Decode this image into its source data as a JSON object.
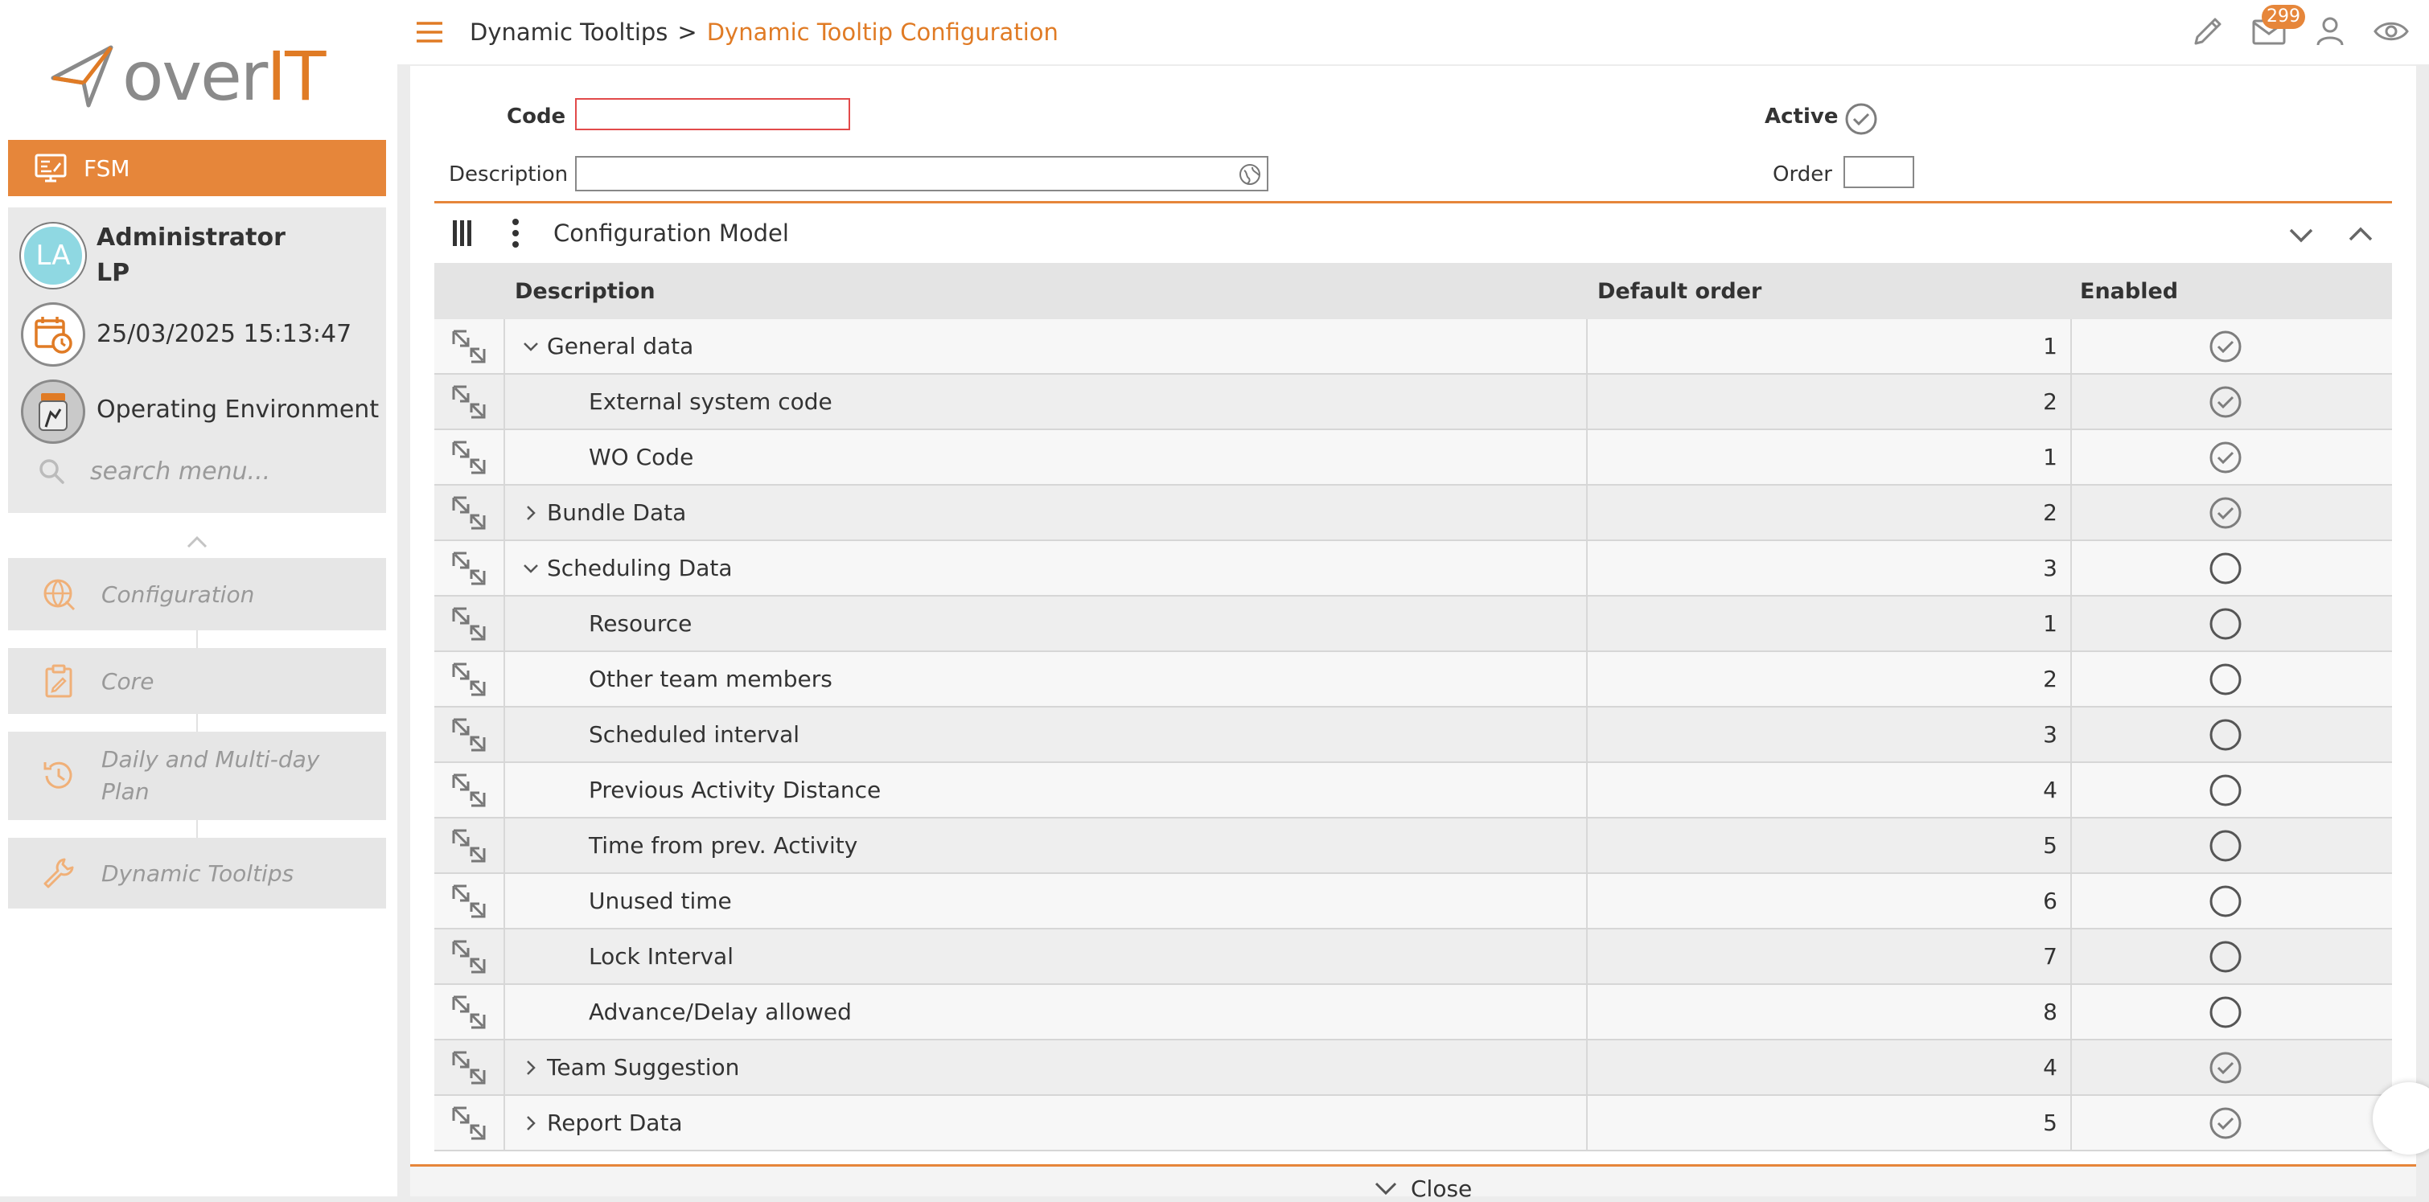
{
  "brand": {
    "logo_part1": "over",
    "logo_part2": "IT",
    "accent": "#e6863a"
  },
  "sidebar": {
    "module": "FSM",
    "user_initials": "LA",
    "user_name_line1": "Administrator",
    "user_name_line2": "LP",
    "datetime": "25/03/2025 15:13:47",
    "environment": "Operating Environment",
    "search_placeholder": "search menu...",
    "items": [
      {
        "label": "Configuration",
        "icon": "globe-icon"
      },
      {
        "label": "Core",
        "icon": "clipboard-edit-icon"
      },
      {
        "label": "Daily and Multi-day Plan",
        "icon": "history-icon"
      },
      {
        "label": "Dynamic Tooltips",
        "icon": "wrench-icon"
      }
    ]
  },
  "header": {
    "breadcrumb_parent": "Dynamic Tooltips",
    "breadcrumb_sep": ">",
    "breadcrumb_current": "Dynamic Tooltip Configuration",
    "mail_count": "299"
  },
  "form": {
    "code_label": "Code",
    "code_value": "",
    "description_label": "Description",
    "description_value": "",
    "active_label": "Active",
    "order_label": "Order",
    "order_value": ""
  },
  "grid": {
    "title": "Configuration Model",
    "columns": [
      "Description",
      "Default order",
      "Enabled"
    ],
    "rows": [
      {
        "desc": "General data",
        "order": "1",
        "enabled": true,
        "level": 0,
        "expand": "down"
      },
      {
        "desc": "External system code",
        "order": "2",
        "enabled": true,
        "level": 1,
        "expand": ""
      },
      {
        "desc": "WO Code",
        "order": "1",
        "enabled": true,
        "level": 1,
        "expand": ""
      },
      {
        "desc": "Bundle Data",
        "order": "2",
        "enabled": true,
        "level": 0,
        "expand": "right"
      },
      {
        "desc": "Scheduling Data",
        "order": "3",
        "enabled": false,
        "level": 0,
        "expand": "down"
      },
      {
        "desc": "Resource",
        "order": "1",
        "enabled": false,
        "level": 1,
        "expand": ""
      },
      {
        "desc": "Other team members",
        "order": "2",
        "enabled": false,
        "level": 1,
        "expand": ""
      },
      {
        "desc": "Scheduled interval",
        "order": "3",
        "enabled": false,
        "level": 1,
        "expand": ""
      },
      {
        "desc": "Previous Activity Distance",
        "order": "4",
        "enabled": false,
        "level": 1,
        "expand": ""
      },
      {
        "desc": "Time from prev. Activity",
        "order": "5",
        "enabled": false,
        "level": 1,
        "expand": ""
      },
      {
        "desc": "Unused time",
        "order": "6",
        "enabled": false,
        "level": 1,
        "expand": ""
      },
      {
        "desc": "Lock Interval",
        "order": "7",
        "enabled": false,
        "level": 1,
        "expand": ""
      },
      {
        "desc": "Advance/Delay allowed",
        "order": "8",
        "enabled": false,
        "level": 1,
        "expand": ""
      },
      {
        "desc": "Team Suggestion",
        "order": "4",
        "enabled": true,
        "level": 0,
        "expand": "right"
      },
      {
        "desc": "Report Data",
        "order": "5",
        "enabled": true,
        "level": 0,
        "expand": "right"
      }
    ]
  },
  "footer": {
    "close_label": "Close"
  }
}
